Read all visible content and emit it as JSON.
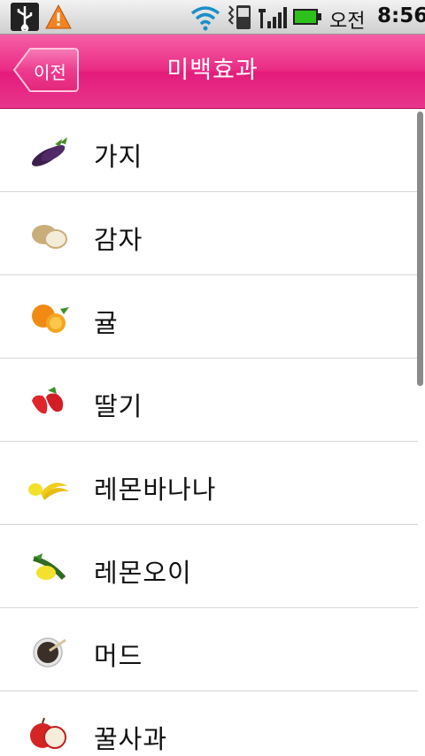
{
  "status_bar": {
    "ampm": "오전",
    "time": "8:56",
    "icons": [
      "usb-icon",
      "warning-icon",
      "wifi-icon",
      "phone-icon",
      "signal-icon",
      "battery-icon"
    ]
  },
  "header": {
    "back_label": "이전",
    "title": "미백효과",
    "color": "#e8287f"
  },
  "list": {
    "items": [
      {
        "label": "가지",
        "icon": "eggplant-icon"
      },
      {
        "label": "감자",
        "icon": "potato-icon"
      },
      {
        "label": "귤",
        "icon": "tangerine-icon"
      },
      {
        "label": "딸기",
        "icon": "strawberry-icon"
      },
      {
        "label": "레몬바나나",
        "icon": "lemon-banana-icon"
      },
      {
        "label": "레몬오이",
        "icon": "lemon-cucumber-icon"
      },
      {
        "label": "머드",
        "icon": "mud-icon"
      },
      {
        "label": "꿀사과",
        "icon": "honey-apple-icon"
      }
    ]
  }
}
